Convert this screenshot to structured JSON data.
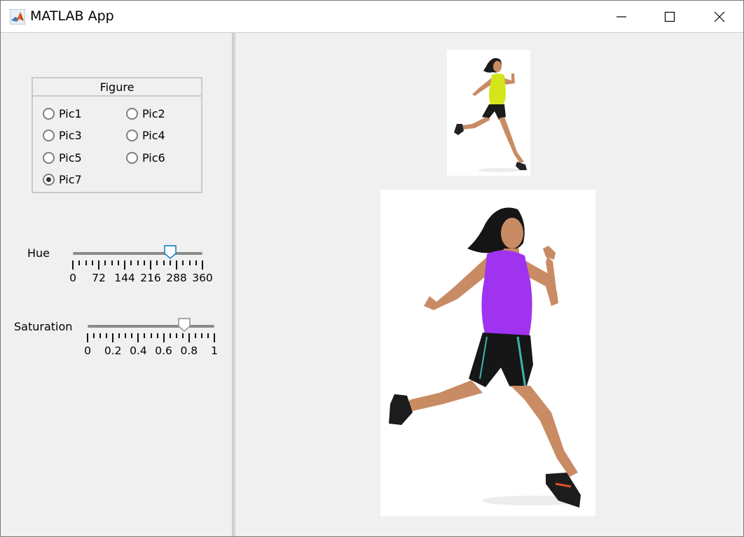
{
  "window": {
    "title": "MATLAB App"
  },
  "colors": {
    "accent": "#0072bd",
    "hue_shirt_small": "#d4e51a",
    "hue_shirt_large": "#a033f0"
  },
  "figure_group": {
    "title": "Figure",
    "options": [
      {
        "label": "Pic1",
        "selected": false
      },
      {
        "label": "Pic2",
        "selected": false
      },
      {
        "label": "Pic3",
        "selected": false
      },
      {
        "label": "Pic4",
        "selected": false
      },
      {
        "label": "Pic5",
        "selected": false
      },
      {
        "label": "Pic6",
        "selected": false
      },
      {
        "label": "Pic7",
        "selected": true
      }
    ]
  },
  "hue_slider": {
    "label": "Hue",
    "value": 270,
    "min": 0,
    "max": 360,
    "tick_labels": [
      "0",
      "72",
      "144",
      "216",
      "288",
      "360"
    ]
  },
  "saturation_slider": {
    "label": "Saturation",
    "value": 0.76,
    "min": 0,
    "max": 1,
    "tick_labels": [
      "0",
      "0.2",
      "0.4",
      "0.6",
      "0.8",
      "1"
    ]
  },
  "images": {
    "original": {
      "icon": "runner-photo-original"
    },
    "processed": {
      "icon": "runner-photo-processed"
    }
  }
}
